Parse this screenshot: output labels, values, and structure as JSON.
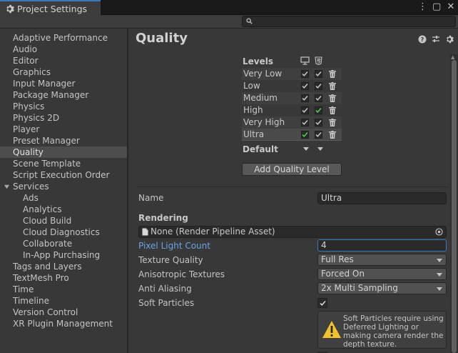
{
  "window": {
    "tab_title": "Project Settings"
  },
  "search": {
    "placeholder": ""
  },
  "sidebar": {
    "items": [
      {
        "label": "Adaptive Performance"
      },
      {
        "label": "Audio"
      },
      {
        "label": "Editor"
      },
      {
        "label": "Graphics"
      },
      {
        "label": "Input Manager"
      },
      {
        "label": "Package Manager"
      },
      {
        "label": "Physics"
      },
      {
        "label": "Physics 2D"
      },
      {
        "label": "Player"
      },
      {
        "label": "Preset Manager"
      },
      {
        "label": "Quality"
      },
      {
        "label": "Scene Template"
      },
      {
        "label": "Script Execution Order"
      },
      {
        "label": "Services"
      },
      {
        "label": "Ads"
      },
      {
        "label": "Analytics"
      },
      {
        "label": "Cloud Build"
      },
      {
        "label": "Cloud Diagnostics"
      },
      {
        "label": "Collaborate"
      },
      {
        "label": "In-App Purchasing"
      },
      {
        "label": "Tags and Layers"
      },
      {
        "label": "TextMesh Pro"
      },
      {
        "label": "Time"
      },
      {
        "label": "Timeline"
      },
      {
        "label": "Version Control"
      },
      {
        "label": "XR Plugin Management"
      }
    ],
    "selected": "Quality"
  },
  "main": {
    "title": "Quality",
    "levels_label": "Levels",
    "levels": [
      {
        "name": "Very Low",
        "standalone": true,
        "mobile": true
      },
      {
        "name": "Low",
        "standalone": true,
        "mobile": true
      },
      {
        "name": "Medium",
        "standalone": true,
        "mobile": true
      },
      {
        "name": "High",
        "standalone": true,
        "mobile": true
      },
      {
        "name": "Very High",
        "standalone": true,
        "mobile": true
      },
      {
        "name": "Ultra",
        "standalone": true,
        "mobile": true
      }
    ],
    "default_label": "Default",
    "add_button": "Add Quality Level",
    "name_label": "Name",
    "name_value": "Ultra",
    "rendering_label": "Rendering",
    "pipeline_asset": "None (Render Pipeline Asset)",
    "pixel_light_label": "Pixel Light Count",
    "pixel_light_value": "4",
    "texture_quality_label": "Texture Quality",
    "texture_quality_value": "Full Res",
    "aniso_label": "Anisotropic Textures",
    "aniso_value": "Forced On",
    "aa_label": "Anti Aliasing",
    "aa_value": "2x Multi Sampling",
    "soft_particles_label": "Soft Particles",
    "soft_particles_checked": true,
    "warning_text": "Soft Particles require using Deferred Lighting or making camera render the depth texture."
  },
  "colors": {
    "accent": "#3a79bb",
    "green_check": "#4ec94e",
    "warning": "#f2c12e"
  }
}
